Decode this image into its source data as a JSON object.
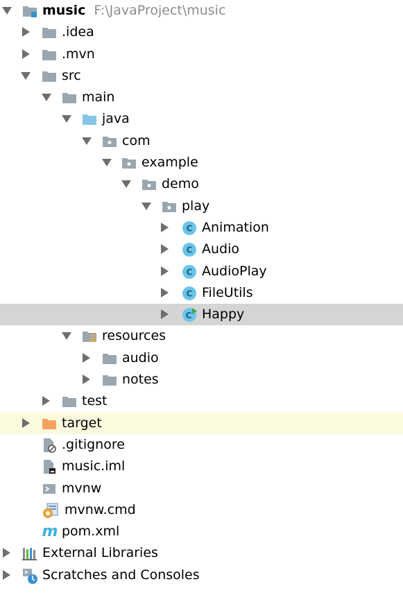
{
  "project": {
    "name": "music",
    "path": "F:\\JavaProject\\music"
  },
  "nodes": {
    "idea": ".idea",
    "mvn": ".mvn",
    "src": "src",
    "main": "main",
    "java": "java",
    "com": "com",
    "example": "example",
    "demo": "demo",
    "play": "play",
    "animation": "Animation",
    "audio_class": "Audio",
    "audioplay": "AudioPlay",
    "fileutils": "FileUtils",
    "happy": "Happy",
    "resources": "resources",
    "audio_dir": "audio",
    "notes": "notes",
    "test": "test",
    "target": "target",
    "gitignore": ".gitignore",
    "music_iml": "music.iml",
    "mvnw": "mvnw",
    "mvnw_cmd": "mvnw.cmd",
    "pom": "pom.xml",
    "external_libraries": "External Libraries",
    "scratches": "Scratches and Consoles"
  },
  "colors": {
    "selected_row": "#d5d5d5",
    "excluded_row": "#fbfadf",
    "folder_gray": "#9aa7b0",
    "source_folder_blue": "#87c6e6",
    "excluded_folder_orange": "#f4a261",
    "class_icon_teal": "#48a7cf",
    "maven_m": "#3fb0e5"
  }
}
